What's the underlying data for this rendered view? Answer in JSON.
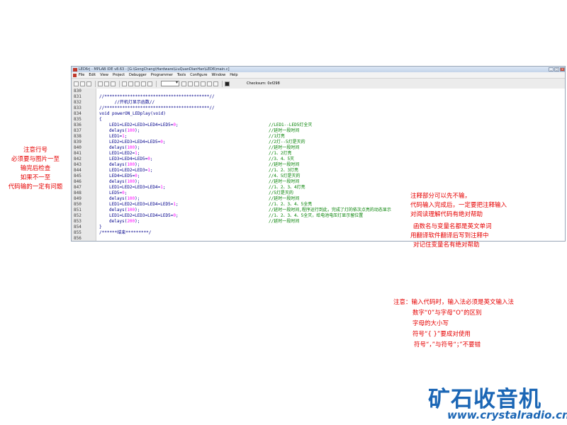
{
  "window": {
    "title": "LED6rj - MPLAB IDE v8.63 - [G:\\GongChang\\Hardware\\LiuQuanDianHan\\LED6\\main.c]",
    "buttons": [
      "_",
      "□",
      "×"
    ]
  },
  "menu": [
    "File",
    "Edit",
    "View",
    "Project",
    "Debugger",
    "Programmer",
    "Tools",
    "Configure",
    "Window",
    "Help"
  ],
  "toolbar": {
    "checksum_label": "Checksum:",
    "checksum_value": "0xf298"
  },
  "code": [
    {
      "ln": "830",
      "text": ""
    },
    {
      "ln": "831",
      "text": "//*****************************************//"
    },
    {
      "ln": "832",
      "text": "      //开机灯显示函数//"
    },
    {
      "ln": "833",
      "text": "//*****************************************//"
    },
    {
      "ln": "834",
      "text": "void powerON_LEDplay(void)"
    },
    {
      "ln": "835",
      "text": "{"
    },
    {
      "ln": "836",
      "code": "LED1=LED2=LED3=LED4=LED5=0;",
      "comment": "//LED1--LED5灯全灭"
    },
    {
      "ln": "837",
      "code": "delays(100);",
      "comment": "//延时一段时间"
    },
    {
      "ln": "838",
      "code": "LED1=1;",
      "comment": "//1灯亮"
    },
    {
      "ln": "839",
      "code": "LED2=LED3=LED4=LED5=0;",
      "comment": "//2灯--5灯是灭的"
    },
    {
      "ln": "840",
      "code": "delays(100);",
      "comment": "//延时一段时间"
    },
    {
      "ln": "841",
      "code": "LED1=LED2=1;",
      "comment": "//1、2灯亮"
    },
    {
      "ln": "842",
      "code": "LED3=LED4=LED5=0;",
      "comment": "//3、4、5灭"
    },
    {
      "ln": "843",
      "code": "delays(100);",
      "comment": "//延时一段时间"
    },
    {
      "ln": "844",
      "code": "LED1=LED2=LED3=1;",
      "comment": "//1、2、3灯亮"
    },
    {
      "ln": "845",
      "code": "LED4=LED5=0;",
      "comment": "//4、5灯是灭的"
    },
    {
      "ln": "846",
      "code": "delays(100);",
      "comment": "//延时一段时间"
    },
    {
      "ln": "847",
      "code": "LED1=LED2=LED3=LED4=1;",
      "comment": "//1、2、3、4灯亮"
    },
    {
      "ln": "848",
      "code": "LED5=0;",
      "comment": "//5灯是灭的"
    },
    {
      "ln": "849",
      "code": "delays(100);",
      "comment": "//延时一段时间"
    },
    {
      "ln": "850",
      "code": "LED1=LED2=LED3=LED4=LED5=1;",
      "comment": "//1、2、3、4、5全亮"
    },
    {
      "ln": "851",
      "code": "delays(100);",
      "comment": "//延时一段时间,程序运行到此，完成了灯的依次点亮的动态显示"
    },
    {
      "ln": "852",
      "code": "LED1=LED2=LED3=LED4=LED5=0;",
      "comment": "//1、2、3、4、5全灭，给电池电压灯显示留位置"
    },
    {
      "ln": "853",
      "code": "delays(200);",
      "comment": "//延时一段时间"
    },
    {
      "ln": "854",
      "text": "}"
    },
    {
      "ln": "855",
      "text": "/******结束*********/"
    },
    {
      "ln": "856",
      "text": ""
    }
  ],
  "notes": {
    "left": [
      "注意行号",
      "必须要与图片一至",
      "输完后检查",
      "如果不一至",
      "代码输的一定有问题"
    ],
    "middle": [
      "注释部分可以先不输，",
      "代码输入完成后，一定要把注释输入",
      "对阅读理解代码有绝对帮助",
      "",
      "函数名与变量名都是英文单词",
      "用翻译软件翻译后写到注释中",
      "对记住变量名有绝对帮助"
    ],
    "bottom": [
      "注意：输入代码时，输入法必须是英文输入法",
      "数字“0”与字母“O”的区别",
      "字母的大小写",
      "符号“{  }”要成对使用",
      "符号“，”与符号“；”不要错"
    ]
  },
  "logo": {
    "name": "矿石收音机",
    "url": "www.crystalradio.cn"
  },
  "colors": {
    "annotation": "#e60000",
    "keyword": "#00008b",
    "number": "#ff00ff",
    "comment": "#008000",
    "logo": "#1b66b5"
  }
}
